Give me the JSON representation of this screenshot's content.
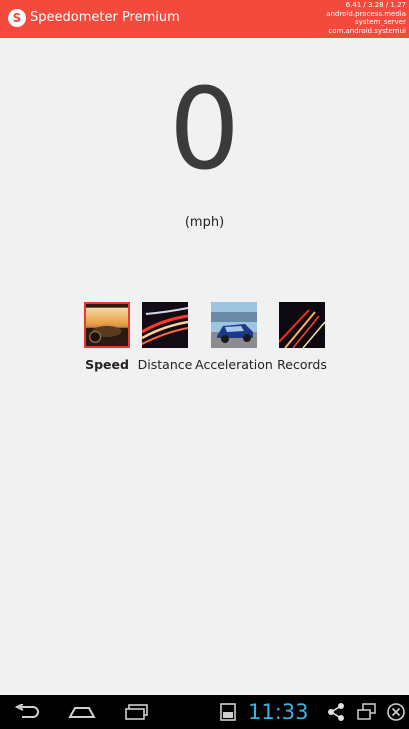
{
  "app_bar": {
    "title": "Speedometer Premium",
    "icon_letter": "S",
    "overlay_lines": [
      "6.41 / 3.28 / 1.27",
      "android.process.media",
      "system_server",
      "com.android.systemui"
    ]
  },
  "speedometer": {
    "value": "0",
    "unit": "(mph)"
  },
  "tabs": [
    {
      "label": "Speed",
      "selected": true,
      "icon": "car-interior-photo"
    },
    {
      "label": "Distance",
      "selected": false,
      "icon": "light-trails-photo"
    },
    {
      "label": "Acceleration",
      "selected": false,
      "icon": "sports-car-photo"
    },
    {
      "label": "Records",
      "selected": false,
      "icon": "night-traffic-photo"
    }
  ],
  "system_bar": {
    "clock": "11:33",
    "icons": [
      "back-icon",
      "home-icon",
      "recent-apps-icon",
      "screenshot-icon",
      "share-icon",
      "screen-mirror-icon",
      "close-icon"
    ]
  },
  "colors": {
    "app_bar": "#f44a3e",
    "background": "#f2f1f2",
    "clock": "#33b5e5",
    "selected_border": "#e53a2f"
  }
}
